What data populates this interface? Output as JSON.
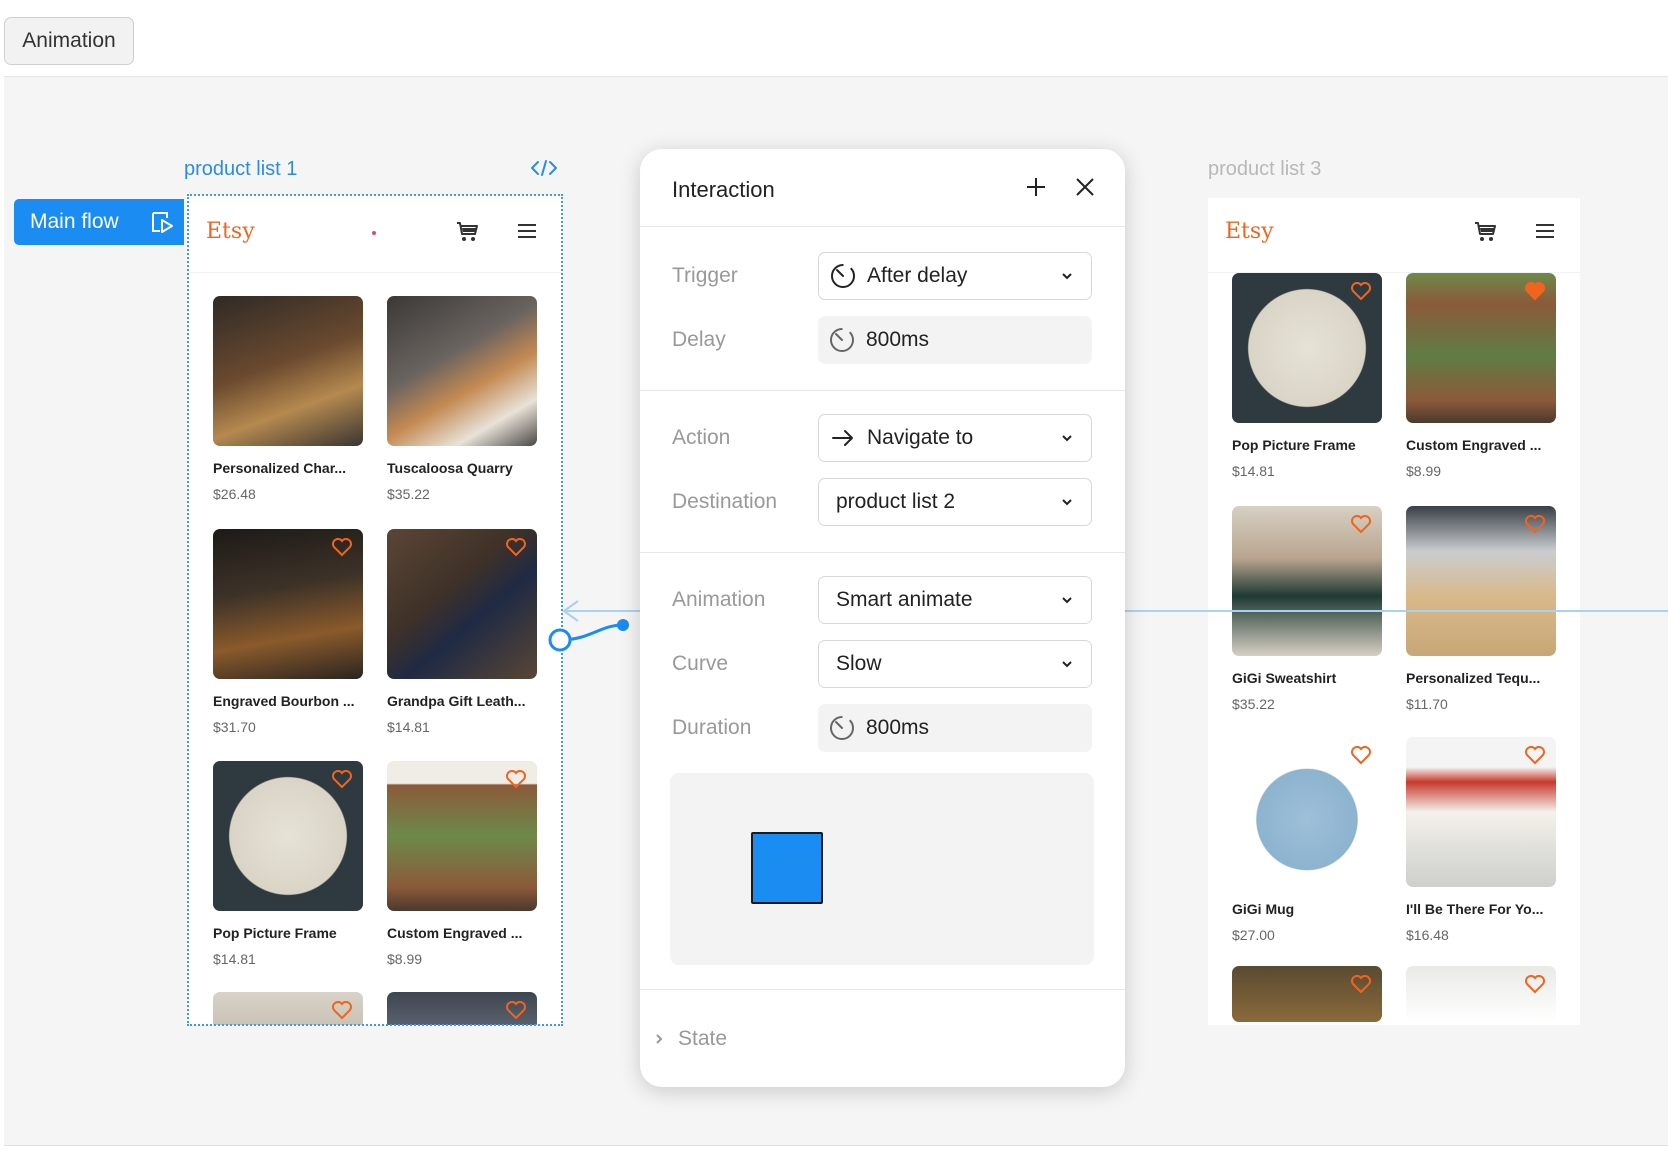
{
  "toolbar": {
    "tab_label": "Animation"
  },
  "canvas": {
    "main_flow_label": "Main flow",
    "frames": [
      {
        "label": "product list 1"
      },
      {
        "label": "product list 3"
      }
    ]
  },
  "etsy_logo": "Etsy",
  "frame1_products": [
    {
      "title": "Personalized Char...",
      "price": "$26.48"
    },
    {
      "title": "Tuscaloosa Quarry",
      "price": "$35.22"
    },
    {
      "title": "Engraved Bourbon ...",
      "price": "$31.70"
    },
    {
      "title": "Grandpa Gift Leath...",
      "price": "$14.81"
    },
    {
      "title": "Pop Picture Frame",
      "price": "$14.81"
    },
    {
      "title": "Custom Engraved ...",
      "price": "$8.99"
    }
  ],
  "frame3_products": [
    {
      "title": "Pop Picture Frame",
      "price": "$14.81"
    },
    {
      "title": "Custom Engraved ...",
      "price": "$8.99"
    },
    {
      "title": "GiGi Sweatshirt",
      "price": "$35.22"
    },
    {
      "title": "Personalized Tequ...",
      "price": "$11.70"
    },
    {
      "title": "GiGi Mug",
      "price": "$27.00"
    },
    {
      "title": "I'll Be There For Yo...",
      "price": "$16.48"
    }
  ],
  "interaction": {
    "title": "Interaction",
    "trigger": {
      "label": "Trigger",
      "value": "After delay"
    },
    "delay": {
      "label": "Delay",
      "value": "800ms"
    },
    "action": {
      "label": "Action",
      "value": "Navigate to"
    },
    "destination": {
      "label": "Destination",
      "value": "product list 2"
    },
    "animation": {
      "label": "Animation",
      "value": "Smart animate"
    },
    "curve": {
      "label": "Curve",
      "value": "Slow"
    },
    "duration": {
      "label": "Duration",
      "value": "800ms"
    },
    "state_label": "State"
  },
  "colors": {
    "accent_blue": "#1b8cf2",
    "etsy_orange": "#f1641e",
    "heart_orange": "#f1641e"
  }
}
